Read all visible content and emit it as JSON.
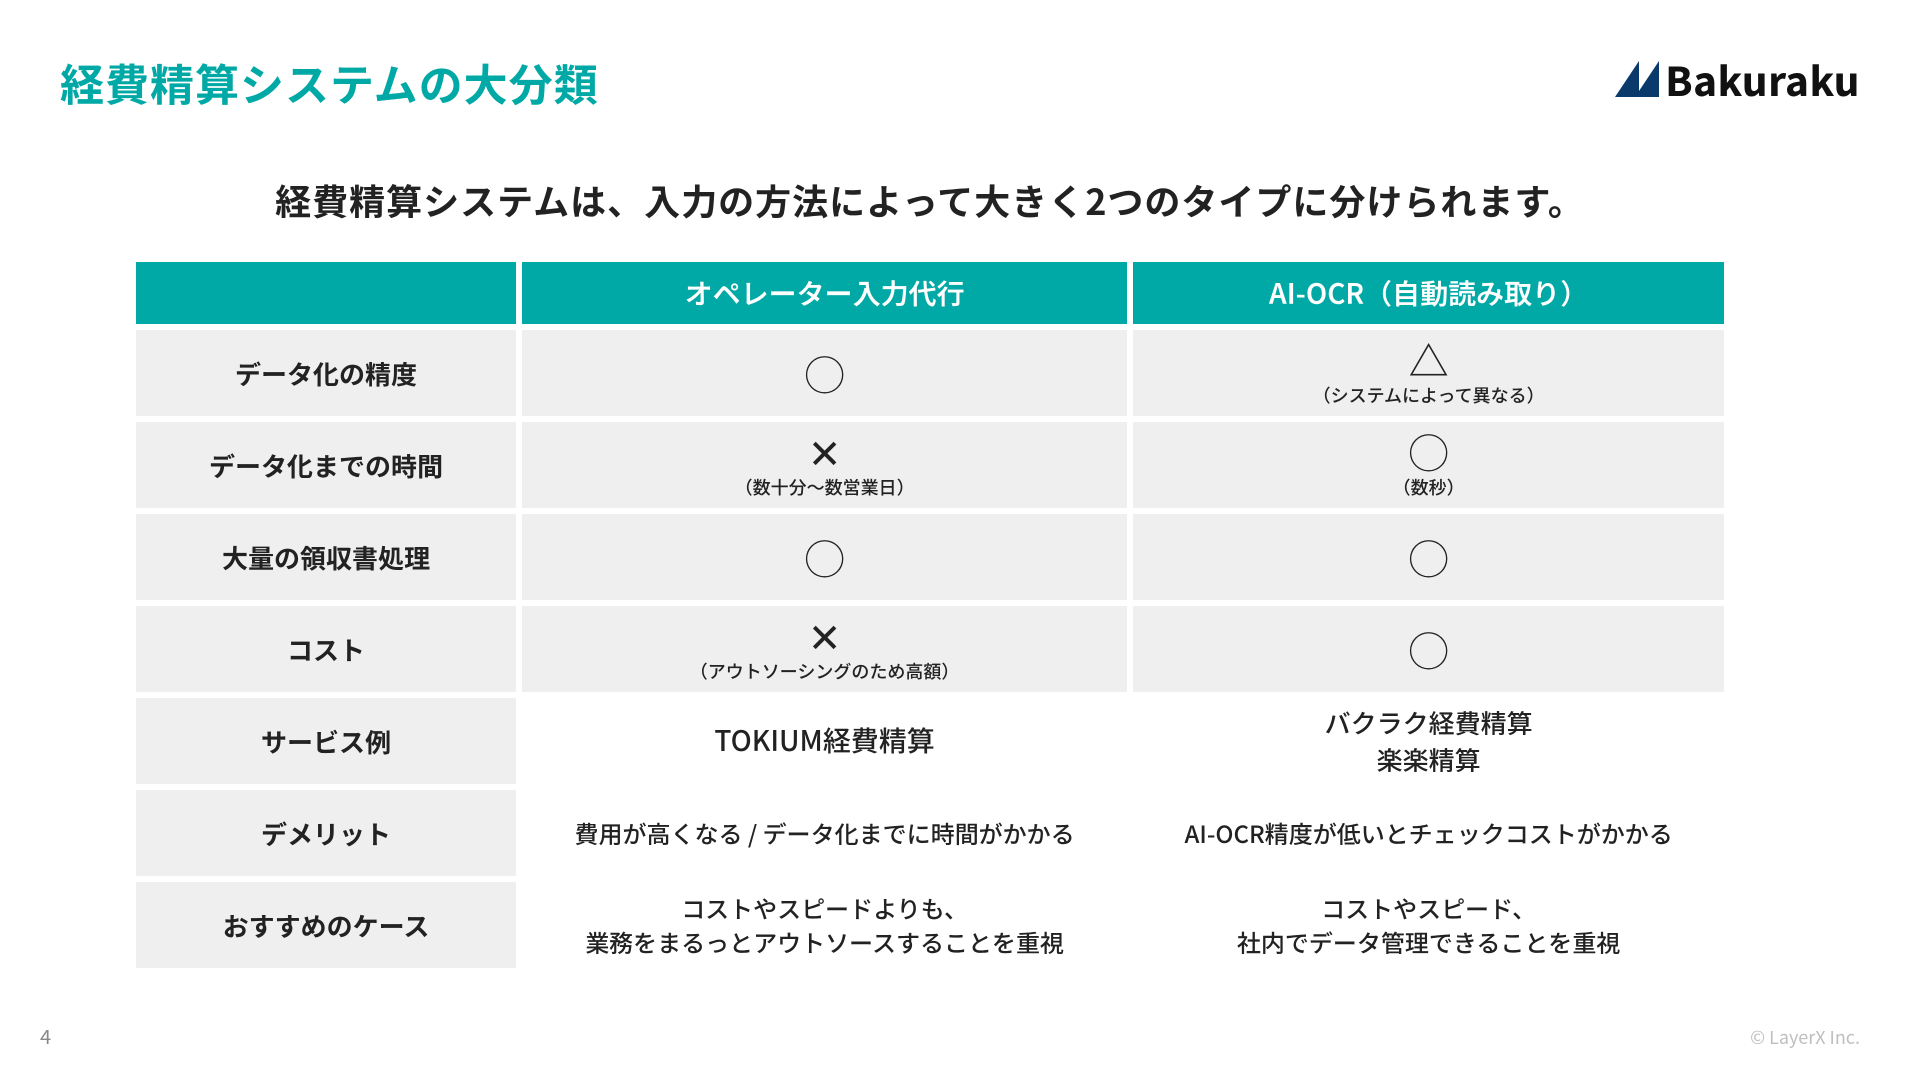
{
  "title": "経費精算システムの大分類",
  "logo_text": "Bakuraku",
  "subtitle": "経費精算システムは、入力の方法によって大きく2つのタイプに分けられます。",
  "columns": {
    "c1": "オペレーター入力代行",
    "c2": "AI-OCR（自動読み取り）"
  },
  "rows": {
    "r1": {
      "label": "データ化の精度",
      "c1_sym": "◯",
      "c2_sym": "△",
      "c2_sub": "（システムによって異なる）"
    },
    "r2": {
      "label": "データ化までの時間",
      "c1_sym": "✕",
      "c1_sub": "（数十分～数営業日）",
      "c2_sym": "◯",
      "c2_sub": "（数秒）"
    },
    "r3": {
      "label": "大量の領収書処理",
      "c1_sym": "◯",
      "c2_sym": "◯"
    },
    "r4": {
      "label": "コスト",
      "c1_sym": "✕",
      "c1_sub": "（アウトソーシングのため高額）",
      "c2_sym": "◯"
    },
    "r5": {
      "label": "サービス例",
      "c1_text": "TOKIUM経費精算",
      "c2_line1": "バクラク経費精算",
      "c2_line2": "楽楽精算"
    },
    "r6": {
      "label": "デメリット",
      "c1_text": "費用が高くなる / データ化までに時間がかかる",
      "c2_text": "AI-OCR精度が低いとチェックコストがかかる"
    },
    "r7": {
      "label": "おすすめのケース",
      "c1_line1": "コストやスピードよりも、",
      "c1_line2": "業務をまるっとアウトソースすることを重視",
      "c2_line1": "コストやスピード、",
      "c2_line2": "社内でデータ管理できることを重視"
    }
  },
  "page_number": "4",
  "copyright": "© LayerX Inc.",
  "colors": {
    "accent": "#00a9a5"
  }
}
